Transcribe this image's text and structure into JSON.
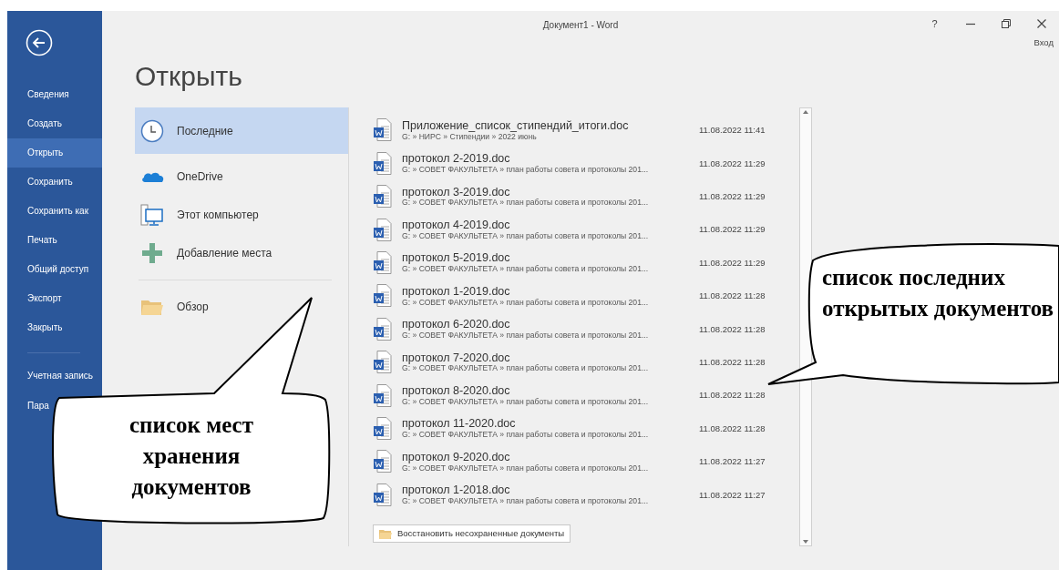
{
  "window": {
    "title": "Документ1 - Word",
    "help": "?",
    "sign_in": "Вход"
  },
  "sidebar": {
    "items": [
      {
        "label": "Сведения",
        "selected": false
      },
      {
        "label": "Создать",
        "selected": false
      },
      {
        "label": "Открыть",
        "selected": true
      },
      {
        "label": "Сохранить",
        "selected": false
      },
      {
        "label": "Сохранить как",
        "selected": false
      },
      {
        "label": "Печать",
        "selected": false
      },
      {
        "label": "Общий доступ",
        "selected": false
      },
      {
        "label": "Экспорт",
        "selected": false
      },
      {
        "label": "Закрыть",
        "selected": false
      }
    ],
    "lower_items": [
      {
        "label": "Учетная запись",
        "selected": false
      },
      {
        "label": "Пара",
        "selected": false
      }
    ]
  },
  "page_title": "Открыть",
  "places": [
    {
      "label": "Последние",
      "kind": "recent",
      "selected": true
    },
    {
      "label": "OneDrive",
      "kind": "cloud",
      "selected": false
    },
    {
      "label": "Этот компьютер",
      "kind": "computer",
      "selected": false
    },
    {
      "label": "Добавление места",
      "kind": "add",
      "selected": false
    }
  ],
  "browse": {
    "label": "Обзор"
  },
  "recent": [
    {
      "name": "Приложение_список_стипендий_итоги.doc",
      "path": "G: » НИРС » Стипендии » 2022 июнь",
      "date": "11.08.2022 11:41"
    },
    {
      "name": "протокол 2-2019.doc",
      "path": "G: » СОВЕТ ФАКУЛЬТЕТА » план работы совета и протоколы 201...",
      "date": "11.08.2022 11:29"
    },
    {
      "name": "протокол 3-2019.doc",
      "path": "G: » СОВЕТ ФАКУЛЬТЕТА » план работы совета и протоколы 201...",
      "date": "11.08.2022 11:29"
    },
    {
      "name": "протокол 4-2019.doc",
      "path": "G: » СОВЕТ ФАКУЛЬТЕТА » план работы совета и протоколы 201...",
      "date": "11.08.2022 11:29"
    },
    {
      "name": "протокол 5-2019.doc",
      "path": "G: » СОВЕТ ФАКУЛЬТЕТА » план работы совета и протоколы 201...",
      "date": "11.08.2022 11:29"
    },
    {
      "name": "протокол 1-2019.doc",
      "path": "G: » СОВЕТ ФАКУЛЬТЕТА » план работы совета и протоколы 201...",
      "date": "11.08.2022 11:28"
    },
    {
      "name": "протокол 6-2020.doc",
      "path": "G: » СОВЕТ ФАКУЛЬТЕТА » план работы совета и протоколы 201...",
      "date": "11.08.2022 11:28"
    },
    {
      "name": "протокол 7-2020.doc",
      "path": "G: » СОВЕТ ФАКУЛЬТЕТА » план работы совета и протоколы 201...",
      "date": "11.08.2022 11:28"
    },
    {
      "name": "протокол 8-2020.doc",
      "path": "G: » СОВЕТ ФАКУЛЬТЕТА » план работы совета и протоколы 201...",
      "date": "11.08.2022 11:28"
    },
    {
      "name": "протокол 11-2020.doc",
      "path": "G: » СОВЕТ ФАКУЛЬТЕТА » план работы совета и протоколы 201...",
      "date": "11.08.2022 11:28"
    },
    {
      "name": "протокол 9-2020.doc",
      "path": "G: » СОВЕТ ФАКУЛЬТЕТА » план работы совета и протоколы 201...",
      "date": "11.08.2022 11:27"
    },
    {
      "name": "протокол 1-2018.doc",
      "path": "G: » СОВЕТ ФАКУЛЬТЕТА » план работы совета и протоколы 201...",
      "date": "11.08.2022 11:27"
    }
  ],
  "restore_button": "Восстановить несохраненные документы",
  "callouts": [
    {
      "text": "список мест хранения документов"
    },
    {
      "text": "список последних открытых документов"
    }
  ]
}
